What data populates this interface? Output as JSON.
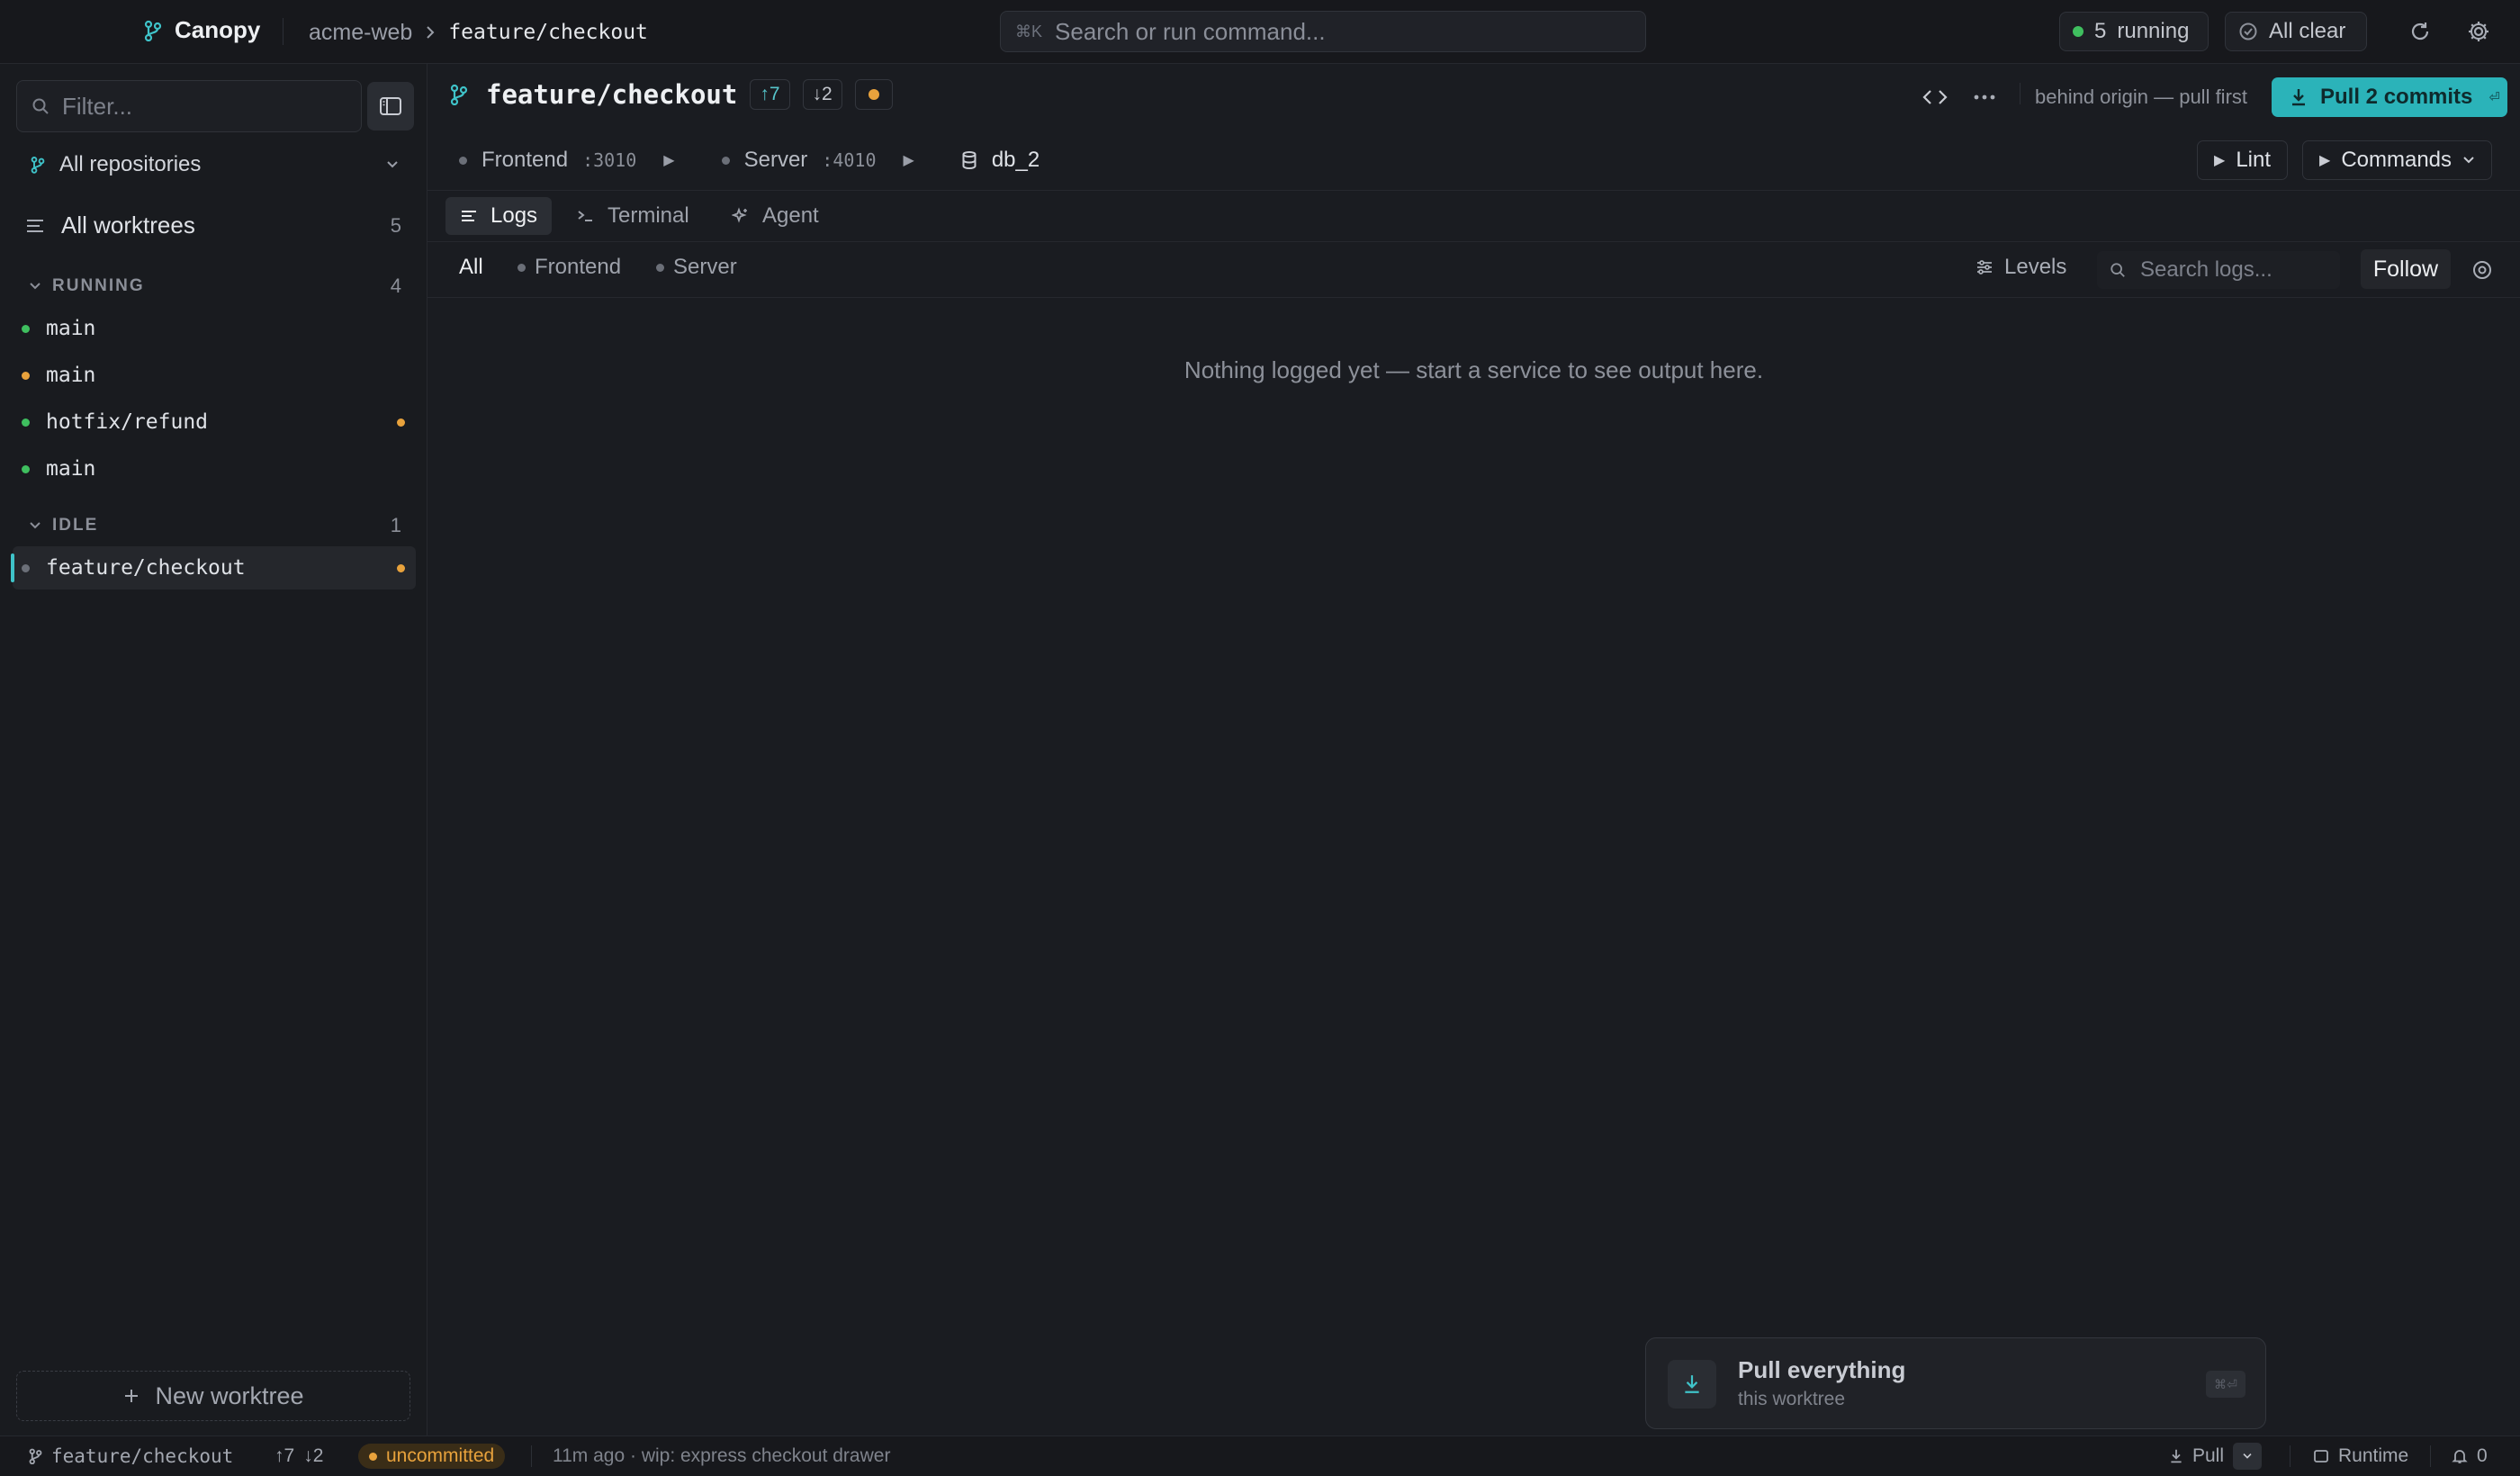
{
  "app": {
    "name": "Canopy",
    "breadcrumb": {
      "repo": "acme-web",
      "branch": "feature/checkout"
    },
    "command": {
      "shortcut": "⌘K",
      "placeholder": "Search or run command..."
    },
    "status": {
      "running_count": "5",
      "running_label": "running",
      "clear_label": "All clear"
    }
  },
  "sidebar": {
    "filter_placeholder": "Filter...",
    "repo_select": "All repositories",
    "all_worktrees": {
      "label": "All worktrees",
      "count": "5"
    },
    "groups": [
      {
        "label": "RUNNING",
        "count": "4",
        "items": [
          {
            "name": "main",
            "status": "green",
            "modified": false
          },
          {
            "name": "main",
            "status": "amber",
            "modified": false
          },
          {
            "name": "hotfix/refund",
            "status": "green",
            "modified": true
          },
          {
            "name": "main",
            "status": "green",
            "modified": false
          }
        ]
      },
      {
        "label": "IDLE",
        "count": "1",
        "items": [
          {
            "name": "feature/checkout",
            "status": "gray",
            "modified": true,
            "selected": true
          }
        ]
      }
    ],
    "new_worktree": "New worktree"
  },
  "worktree": {
    "branch": "feature/checkout",
    "ahead": "↑7",
    "behind": "↓2",
    "behind_note": "behind origin — pull first",
    "pull_button": "Pull 2 commits",
    "pull_hint": "⏎",
    "services": [
      {
        "name": "Frontend",
        "port": ":3010"
      },
      {
        "name": "Server",
        "port": ":4010"
      }
    ],
    "database": "db_2",
    "lint_label": "Lint",
    "commands_label": "Commands"
  },
  "tabs": [
    "Logs",
    "Terminal",
    "Agent"
  ],
  "log_filters": [
    "All",
    "Frontend",
    "Server"
  ],
  "levels_label": "Levels",
  "log_search_placeholder": "Search logs...",
  "follow_label": "Follow",
  "empty_message": "Nothing logged yet — start a service to see output here.",
  "toast": {
    "title": "Pull everything",
    "subtitle": "this worktree",
    "shortcut": "⌘⏎"
  },
  "statusbar": {
    "branch": "feature/checkout",
    "ahead": "↑7",
    "behind": "↓2",
    "uncommitted": "uncommitted",
    "last_commit": "11m ago · wip: express checkout drawer",
    "pull_label": "Pull",
    "runtime_label": "Runtime",
    "notifications": "0"
  },
  "colors": {
    "accent": "#2bb3b9",
    "running": "#3fbf5f",
    "modified": "#e8a23c",
    "idle": "#6b6f78"
  }
}
